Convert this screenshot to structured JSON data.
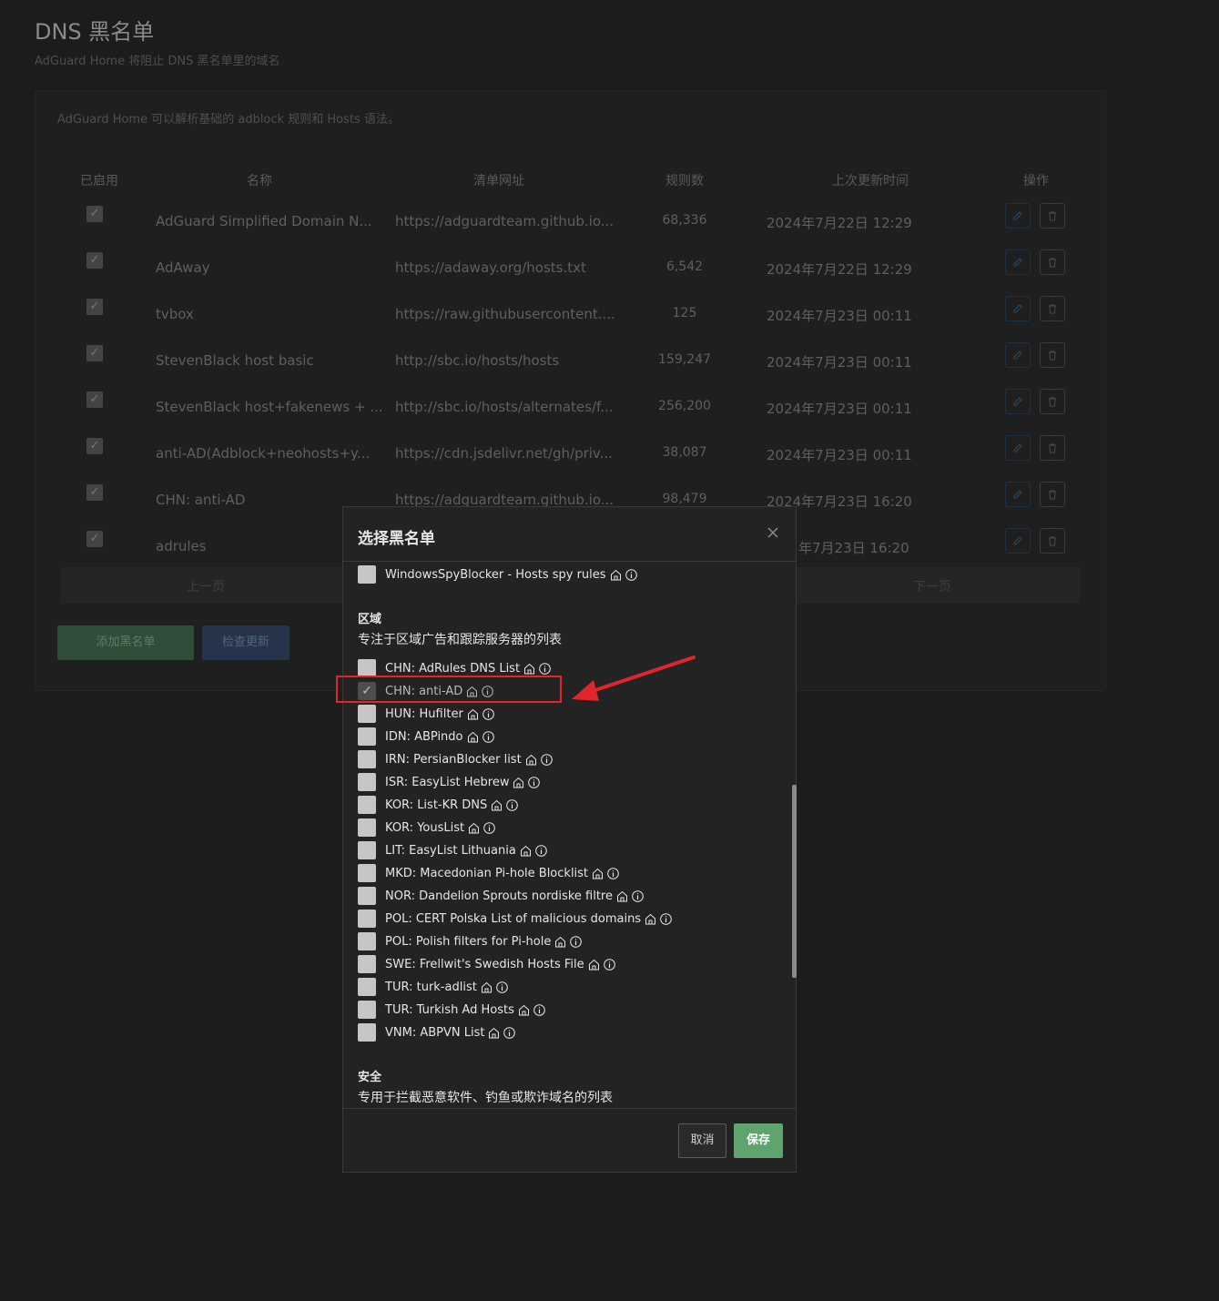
{
  "page": {
    "title": "DNS 黑名单",
    "subtitle": "AdGuard Home 将阻止 DNS 黑名单里的域名"
  },
  "card": {
    "description": "AdGuard Home 可以解析基础的 adblock 规则和 Hosts 语法。",
    "headers": {
      "enabled": "已启用",
      "name": "名称",
      "url": "清单网址",
      "rules": "规则数",
      "updated": "上次更新时间",
      "actions": "操作"
    },
    "rows": [
      {
        "name": "AdGuard Simplified Domain N...",
        "url": "https://adguardteam.github.io...",
        "rules": "68,336",
        "updated": "2024年7月22日 12:29"
      },
      {
        "name": "AdAway",
        "url": "https://adaway.org/hosts.txt",
        "rules": "6,542",
        "updated": "2024年7月22日 12:29"
      },
      {
        "name": "tvbox",
        "url": "https://raw.githubusercontent....",
        "rules": "125",
        "updated": "2024年7月23日 00:11"
      },
      {
        "name": "StevenBlack host basic",
        "url": "http://sbc.io/hosts/hosts",
        "rules": "159,247",
        "updated": "2024年7月23日 00:11"
      },
      {
        "name": "StevenBlack host+fakenews + ...",
        "url": "http://sbc.io/hosts/alternates/f...",
        "rules": "256,200",
        "updated": "2024年7月23日 00:11"
      },
      {
        "name": "anti-AD(Adblock+neohosts+y...",
        "url": "https://cdn.jsdelivr.net/gh/priv...",
        "rules": "38,087",
        "updated": "2024年7月23日 00:11"
      },
      {
        "name": "CHN: anti-AD",
        "url": "https://adguardteam.github.io...",
        "rules": "98,479",
        "updated": "2024年7月23日 16:20"
      },
      {
        "name": "adrules",
        "url": "",
        "rules": "",
        "updated": "年7月23日 16:20"
      }
    ],
    "pager": {
      "prev": "上一页",
      "next": "下一页"
    },
    "add_button": "添加黑名单",
    "check_button": "检查更新"
  },
  "modal": {
    "title": "选择黑名单",
    "top_item": "WindowsSpyBlocker - Hosts spy rules",
    "region_title": "区域",
    "region_desc": "专注于区域广告和跟踪服务器的列表",
    "region_items": [
      "CHN: AdRules DNS List",
      "CHN: anti-AD",
      "HUN: Hufilter",
      "IDN: ABPindo",
      "IRN: PersianBlocker list",
      "ISR: EasyList Hebrew",
      "KOR: List-KR DNS",
      "KOR: YousList",
      "LIT: EasyList Lithuania",
      "MKD: Macedonian Pi-hole Blocklist",
      "NOR: Dandelion Sprouts nordiske filtre",
      "POL: CERT Polska List of malicious domains",
      "POL: Polish filters for Pi-hole",
      "SWE: Frellwit's Swedish Hosts File",
      "TUR: turk-adlist",
      "TUR: Turkish Ad Hosts",
      "VNM: ABPVN List"
    ],
    "checked_item": "CHN: anti-AD",
    "security_title": "安全",
    "security_desc": "专用于拦截恶意软件、钓鱼或欺诈域名的列表",
    "cancel": "取消",
    "save": "保存"
  },
  "colors": {
    "highlight": "#e0262a",
    "save": "#5fa36d"
  }
}
